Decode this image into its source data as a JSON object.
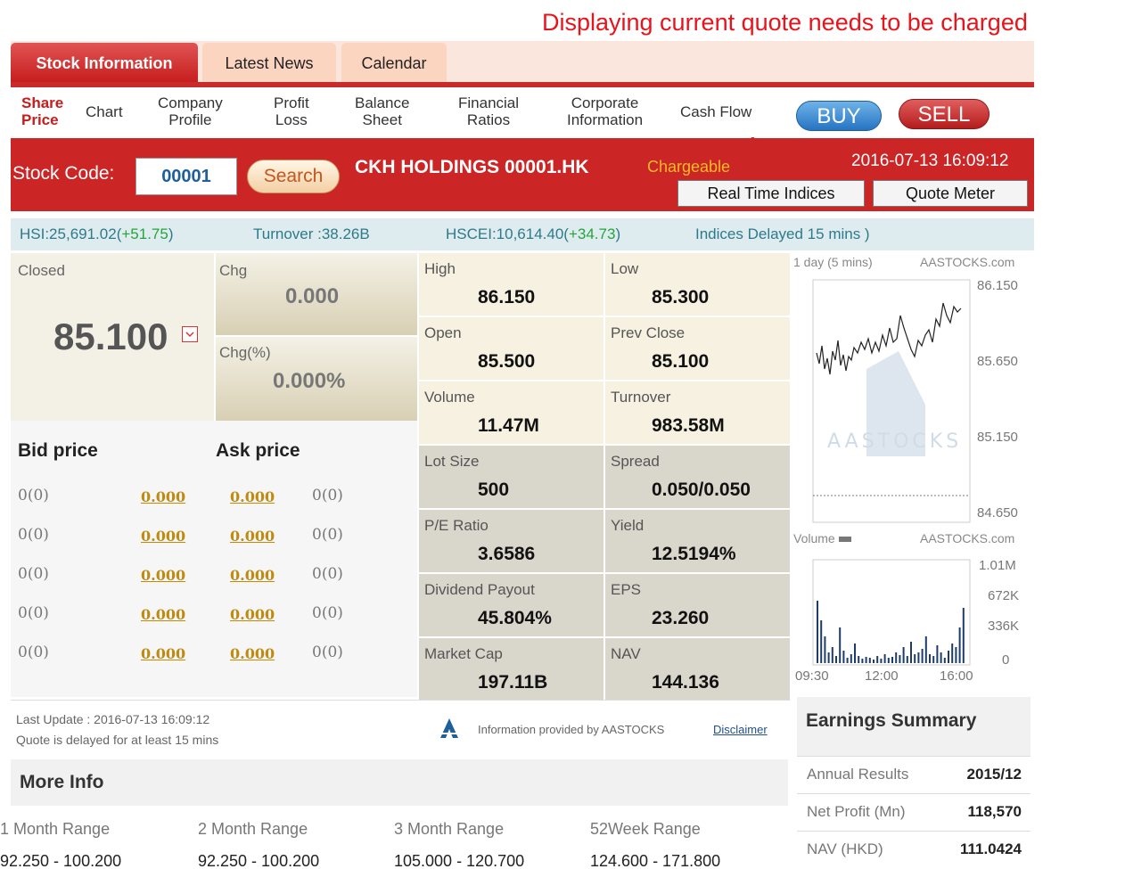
{
  "annotation": {
    "text": "Displaying current quote needs to be charged"
  },
  "tabs": [
    "Stock Information",
    "Latest News",
    "Calendar"
  ],
  "subnav": {
    "share_price": [
      "Share",
      "Price"
    ],
    "chart": "Chart",
    "company_profile": [
      "Company",
      "Profile"
    ],
    "profit_loss": [
      "Profit",
      "Loss"
    ],
    "balance_sheet": [
      "Balance",
      "Sheet"
    ],
    "financial_ratios": [
      "Financial",
      "Ratios"
    ],
    "corporate_info": [
      "Corporate",
      "Information"
    ],
    "cash_flow": "Cash Flow",
    "buy": "BUY",
    "sell": "SELL"
  },
  "quote_bar": {
    "stock_code_label": "Stock Code:",
    "stock_code_value": "00001",
    "search_label": "Search",
    "stock_name": "CKH HOLDINGS 00001.HK",
    "chargeable": "Chargeable",
    "timestamp": "2016-07-13 16:09:12",
    "real_time_indices": "Real Time Indices",
    "quote_meter": "Quote Meter"
  },
  "index_bar": {
    "hsi": "HSI:25,691.02(",
    "hsi_change": "+51.75",
    "hsi_close": ")",
    "turnover": "Turnover :38.26B",
    "hscei": "HSCEI:10,614.40(",
    "hscei_change": "+34.73",
    "hscei_close": ")",
    "delayed": "Indices Delayed 15 mins )"
  },
  "quote": {
    "closed_label": "Closed",
    "closed_value": "85.100",
    "chg_label": "Chg",
    "chg_value": "0.000",
    "chgp_label": "Chg(%)",
    "chgp_value": "0.000%"
  },
  "bid_ask": {
    "bid_label": "Bid price",
    "ask_label": "Ask price",
    "rows": [
      {
        "bid_vol": "0(0)",
        "bid": "0.000",
        "ask": "0.000",
        "ask_vol": "0(0)"
      },
      {
        "bid_vol": "0(0)",
        "bid": "0.000",
        "ask": "0.000",
        "ask_vol": "0(0)"
      },
      {
        "bid_vol": "0(0)",
        "bid": "0.000",
        "ask": "0.000",
        "ask_vol": "0(0)"
      },
      {
        "bid_vol": "0(0)",
        "bid": "0.000",
        "ask": "0.000",
        "ask_vol": "0(0)"
      },
      {
        "bid_vol": "0(0)",
        "bid": "0.000",
        "ask": "0.000",
        "ask_vol": "0(0)"
      }
    ]
  },
  "stats": {
    "high": {
      "label": "High",
      "value": "86.150"
    },
    "low": {
      "label": "Low",
      "value": "85.300"
    },
    "open": {
      "label": "Open",
      "value": "85.500"
    },
    "prev_close": {
      "label": "Prev Close",
      "value": "85.100"
    },
    "volume": {
      "label": "Volume",
      "value": "11.47M"
    },
    "turnover": {
      "label": "Turnover",
      "value": "983.58M"
    },
    "lot_size": {
      "label": "Lot Size",
      "value": "500"
    },
    "spread": {
      "label": "Spread",
      "value": "0.050/0.050"
    },
    "pe": {
      "label": "P/E Ratio",
      "value": "3.6586"
    },
    "yield": {
      "label": "Yield",
      "value": "12.5194%"
    },
    "div_payout": {
      "label": "Dividend Payout",
      "value": "45.804%"
    },
    "eps": {
      "label": "EPS",
      "value": "23.260"
    },
    "market_cap": {
      "label": "Market Cap",
      "value": "197.11B"
    },
    "nav": {
      "label": "NAV",
      "value": "144.136"
    }
  },
  "chart": {
    "period": "1 day (5 mins)",
    "source": "AASTOCKS.com",
    "watermark": "AASTOCKS",
    "price_ticks": [
      "86.150",
      "85.650",
      "85.150",
      "84.650"
    ],
    "volume_label": "Volume",
    "volume_ticks": [
      "1.01M",
      "672K",
      "336K",
      "0"
    ],
    "time_ticks": [
      "09:30",
      "12:00",
      "16:00"
    ]
  },
  "footer": {
    "last_update": "Last Update : 2016-07-13 16:09:12",
    "delay_note": "Quote is delayed for at least 15 mins",
    "provided_by": "Information provided by AASTOCKS",
    "disclaimer": "Disclaimer"
  },
  "more_info": {
    "title": "More Info",
    "ranges": [
      {
        "label": "1 Month Range",
        "value": "92.250 - 100.200"
      },
      {
        "label": "2 Month Range",
        "value": "92.250 - 100.200"
      },
      {
        "label": "3 Month Range",
        "value": "105.000 - 120.700"
      },
      {
        "label": "52Week Range",
        "value": "124.600 - 171.800"
      }
    ]
  },
  "earnings": {
    "title": "Earnings Summary",
    "rows": [
      {
        "label": "Annual Results",
        "value": "2015/12"
      },
      {
        "label": "Net Profit (Mn)",
        "value": "118,570"
      },
      {
        "label": "NAV (HKD)",
        "value": "111.0424"
      }
    ]
  },
  "colors": {
    "brand_red": "#cc2526",
    "up_green": "#24a53b",
    "annotation_red": "#e8131b",
    "buy_blue": "#2574c2"
  }
}
